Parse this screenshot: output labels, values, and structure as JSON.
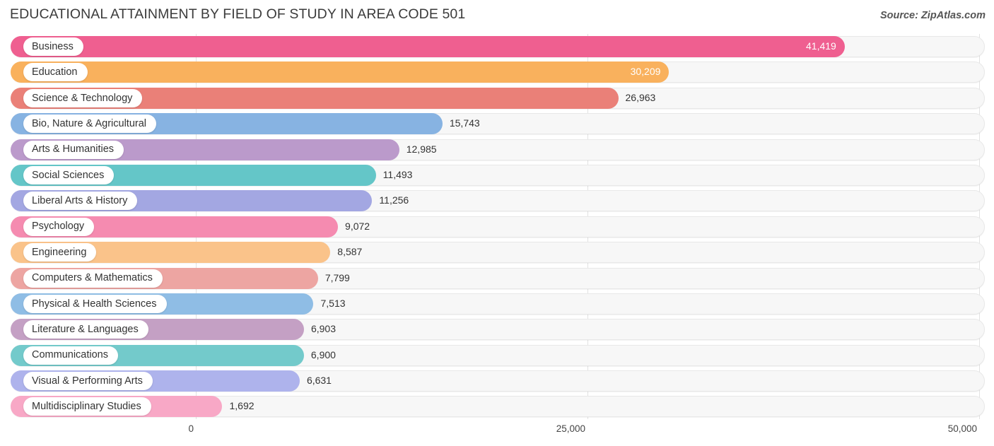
{
  "header": {
    "title": "EDUCATIONAL ATTAINMENT BY FIELD OF STUDY IN AREA CODE 501",
    "source": "Source: ZipAtlas.com"
  },
  "chart_data": {
    "type": "bar",
    "orientation": "horizontal",
    "title": "EDUCATIONAL ATTAINMENT BY FIELD OF STUDY IN AREA CODE 501",
    "xlabel": "",
    "ylabel": "",
    "xlim": [
      0,
      50000
    ],
    "grid": true,
    "legend": "none",
    "xticks": [
      "0",
      "25,000",
      "50,000"
    ],
    "xtick_values": [
      0,
      25000,
      50000
    ],
    "categories": [
      "Business",
      "Education",
      "Science & Technology",
      "Bio, Nature & Agricultural",
      "Arts & Humanities",
      "Social Sciences",
      "Liberal Arts & History",
      "Psychology",
      "Engineering",
      "Computers & Mathematics",
      "Physical & Health Sciences",
      "Literature & Languages",
      "Communications",
      "Visual & Performing Arts",
      "Multidisciplinary Studies"
    ],
    "values": [
      41419,
      30209,
      26963,
      15743,
      12985,
      11493,
      11256,
      9072,
      8587,
      7799,
      7513,
      6903,
      6900,
      6631,
      1692
    ],
    "value_labels": [
      "41,419",
      "30,209",
      "26,963",
      "15,743",
      "12,985",
      "11,493",
      "11,256",
      "9,072",
      "8,587",
      "7,799",
      "7,513",
      "6,903",
      "6,900",
      "6,631",
      "1,692"
    ],
    "colors": [
      "#ef5f90",
      "#f9b15d",
      "#ea8078",
      "#87b3e2",
      "#bb9acb",
      "#64c6c8",
      "#a3a7e2",
      "#f58bb0",
      "#fac38a",
      "#eda5a2",
      "#8fbde5",
      "#c4a0c4",
      "#73cacb",
      "#aeb3ec",
      "#f8a8c6"
    ],
    "label_inside": [
      true,
      true,
      false,
      false,
      false,
      false,
      false,
      false,
      false,
      false,
      false,
      false,
      false,
      false,
      false
    ]
  },
  "axis": {
    "ticks": [
      {
        "label": "0",
        "value": 0
      },
      {
        "label": "25,000",
        "value": 25000
      },
      {
        "label": "50,000",
        "value": 50000
      }
    ]
  }
}
